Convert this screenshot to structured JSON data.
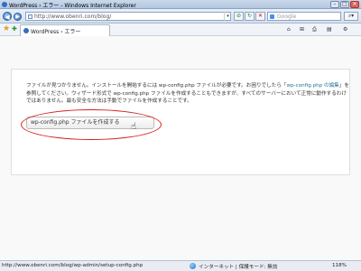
{
  "window": {
    "title": "WordPress › エラー - Windows Internet Explorer"
  },
  "address": {
    "url": "http://www.obenri.com/blog/",
    "search_placeholder": "Google"
  },
  "tab": {
    "label": "WordPress › エラー"
  },
  "commands": {
    "home": "⌂",
    "feeds": "⊞",
    "print": "⎙",
    "page": "▤",
    "tools": "⚙"
  },
  "message": {
    "part1": "ファイルが見つかりません。インストールを開始するには wp-config.php ファイルが必要です。お困りでしたら「",
    "link": "wp-config.php の編集",
    "part2": "」を参照してください。ウィザード形式で wp-config.php ファイルを作成することもできますが、すべてのサーバーにおいて正常に動作するわけではありません。最も安全な方法は手動でファイルを作成することです。",
    "button": "wp-config.php ファイルを作成する"
  },
  "status": {
    "url": "http://www.obenri.com/blog/wp-admin/setup-config.php",
    "zone": "インターネット | 保護モード: 無効",
    "zoom": "118%"
  },
  "colors": {
    "link": "#21759b",
    "highlight": "#d62020"
  }
}
